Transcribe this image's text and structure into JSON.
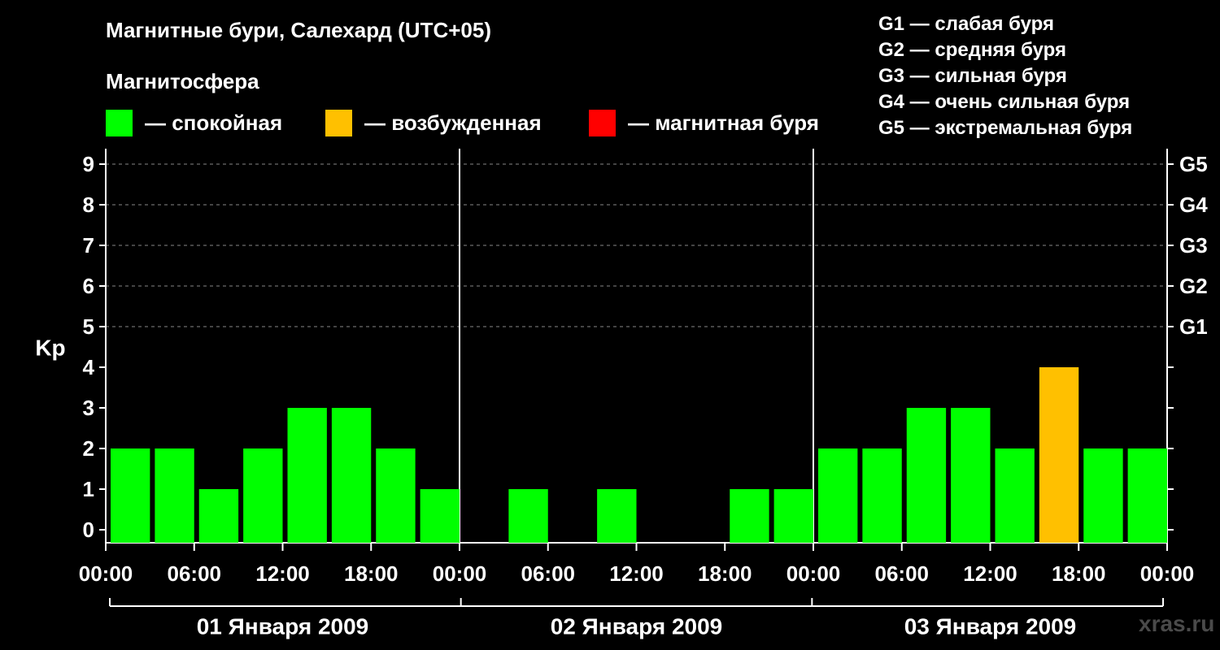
{
  "chart_data": {
    "type": "bar",
    "title": "Магнитные бури, Салехард (UTC+05)",
    "subtitle": "Магнитосфера",
    "ylabel": "Kp",
    "ylim": [
      0,
      9
    ],
    "yticks": [
      "0",
      "1",
      "2",
      "3",
      "4",
      "5",
      "6",
      "7",
      "8",
      "9"
    ],
    "right_ticks": [
      {
        "kp": 5,
        "label": "G1"
      },
      {
        "kp": 6,
        "label": "G2"
      },
      {
        "kp": 7,
        "label": "G3"
      },
      {
        "kp": 8,
        "label": "G4"
      },
      {
        "kp": 9,
        "label": "G5"
      }
    ],
    "grid": "dashed, Kp 5–9",
    "legend": {
      "placement": "top",
      "items": [
        {
          "label": "— спокойная",
          "color": "#00ff00"
        },
        {
          "label": "— возбужденная",
          "color": "#ffc000"
        },
        {
          "label": "— магнитная буря",
          "color": "#ff0000"
        }
      ]
    },
    "g_legend": [
      "G1 — слабая буря",
      "G2 — средняя буря",
      "G3 — сильная буря",
      "G4 — очень сильная буря",
      "G5 — экстремальная буря"
    ],
    "xticks": [
      "00:00",
      "06:00",
      "12:00",
      "18:00",
      "00:00",
      "06:00",
      "12:00",
      "18:00",
      "00:00",
      "06:00",
      "12:00",
      "18:00",
      "00:00"
    ],
    "days": [
      "01 Января 2009",
      "02 Января 2009",
      "03 Января 2009"
    ],
    "interval_hours": 3,
    "series": [
      {
        "values": [
          2,
          2,
          1,
          2,
          3,
          3,
          2,
          1,
          0,
          1,
          0,
          1,
          0,
          0,
          1,
          1,
          2,
          2,
          3,
          3,
          2,
          4,
          2,
          2
        ]
      }
    ],
    "colors": {
      "quiet": "#00ff00",
      "active": "#ffc000",
      "storm": "#ff0000"
    }
  },
  "watermark": "xras.ru"
}
